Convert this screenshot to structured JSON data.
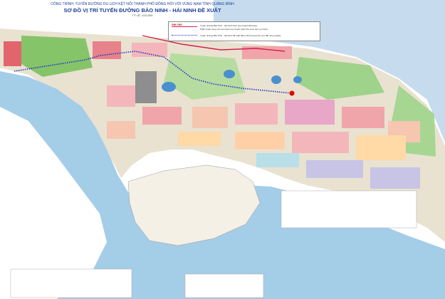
{
  "header": {
    "line1": "CÔNG TRÌNH: TUYẾN ĐƯỜNG DU LỊCH KẾT NỐI THÀNH PHỐ ĐỒNG HỚI VỚI VÙNG NAM TỈNH QUẢNG BÌNH",
    "title": "SƠ ĐỒ VỊ TRÍ TUYẾN ĐƯỜNG BẢO NINH - HẢI NINH ĐỀ XUẤT",
    "scale": "TỶ LỆ: 1/10.000"
  },
  "legend": {
    "title": "GHI CHÚ",
    "items": [
      {
        "label": "Tuyến đường Bảo Ninh - Hải Ninh theo Quy hoạch đã duyệt",
        "color": "#d62050"
      },
      {
        "label": "Phần tuyến trùng với các tuyến quy hoạch phân khu (trục dọc ven biển)"
      },
      {
        "label": "Tuyến đường Bảo Ninh - Hải Ninh đề xuất điều chỉnh đi qua khu vực đất nông nghiệp",
        "color": "#2233cc"
      }
    ]
  },
  "colors": {
    "sea": "#c6dcee",
    "river": "#a4cde8",
    "land": "#e9e2d0",
    "proposed_route": "#2233cc",
    "approved_route": "#d62050",
    "endpoint": "#e00000"
  }
}
